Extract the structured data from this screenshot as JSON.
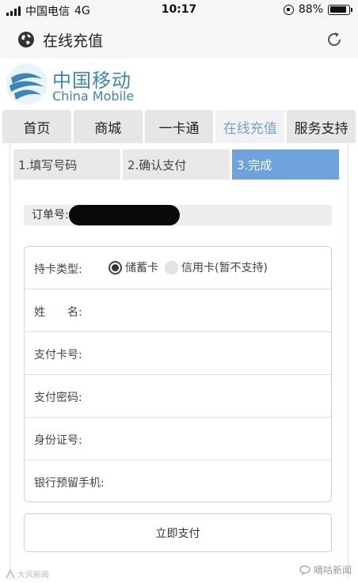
{
  "status_bar": {
    "carrier": "中国电信",
    "network": "4G",
    "time": "10:17",
    "battery": "88%",
    "battery_level": 0.88
  },
  "title_bar": {
    "title": "在线充值"
  },
  "logo": {
    "name_cn": "中国移动",
    "name_en": "China Mobile",
    "brand_color": "#3a86b8"
  },
  "nav": {
    "tabs": [
      {
        "label": "首页"
      },
      {
        "label": "商城"
      },
      {
        "label": "一卡通"
      },
      {
        "label": "在线充值"
      },
      {
        "label": "服务支持"
      }
    ],
    "active_index": 3,
    "active_color": "#6fa3cf"
  },
  "steps": [
    {
      "label": "1.填写号码"
    },
    {
      "label": "2.确认支付"
    },
    {
      "label": "3.完成"
    }
  ],
  "order": {
    "label": "订单号:"
  },
  "form": {
    "card_type_label": "持卡类型:",
    "debit_label": "储蓄卡",
    "credit_label": "信用卡(暂不支持)",
    "name_label": "姓　　名:",
    "card_number_label": "支付卡号:",
    "password_label": "支付密码:",
    "id_label": "身份证号:",
    "phone_label": "银行预留手机:"
  },
  "pay_button": {
    "label": "立即支付"
  },
  "watermarks": {
    "left": "大风新闻",
    "right": "嘀咕新闻"
  },
  "icons": [
    "signal-icon",
    "battery-icon",
    "rotation-lock-icon",
    "globe-icon",
    "refresh-icon",
    "china-mobile-logo"
  ]
}
